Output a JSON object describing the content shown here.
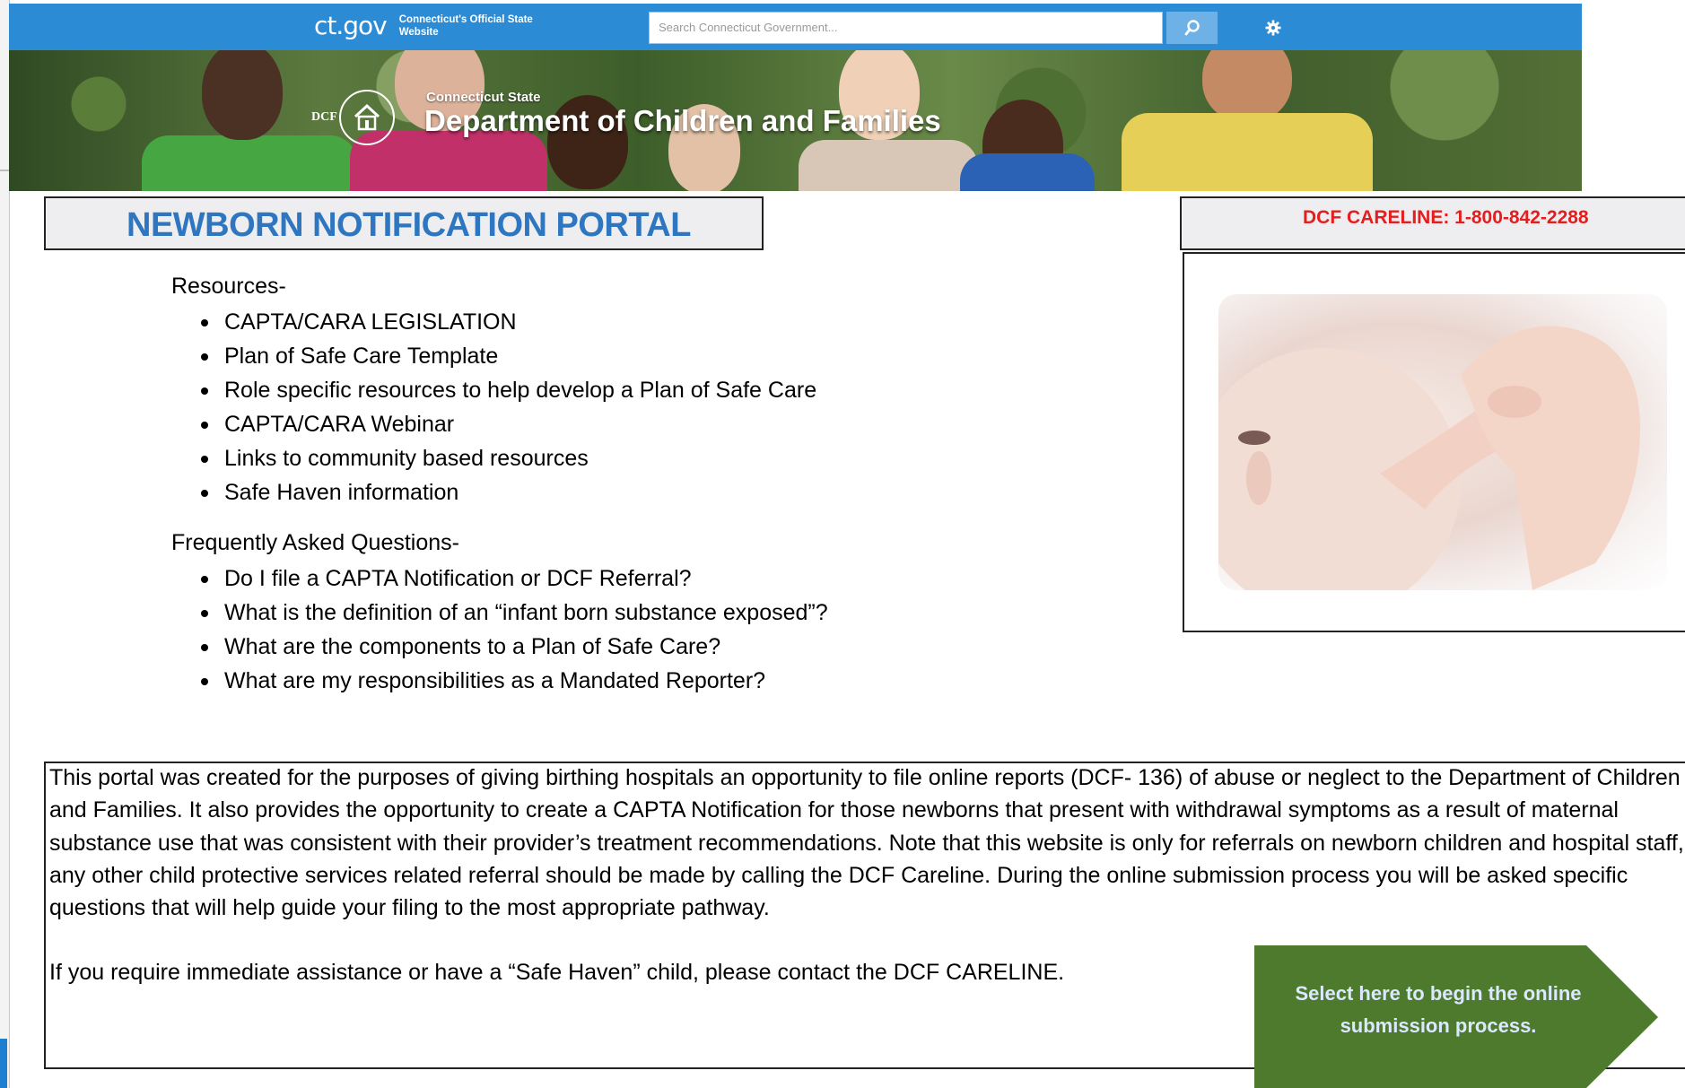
{
  "header": {
    "site_logo": "ct.gov",
    "site_tagline": "Connecticut's Official State Website",
    "search_placeholder": "Search Connecticut Government...",
    "search_icon": "search-icon",
    "settings_icon": "gear-icon"
  },
  "banner": {
    "logo_text": "DCF",
    "state_label": "Connecticut State",
    "department": "Department of Children and Families"
  },
  "page_title": "NEWBORN NOTIFICATION PORTAL",
  "careline": "DCF CARELINE: 1-800-842-2288",
  "resources": {
    "heading": "Resources-",
    "items": [
      "CAPTA/CARA LEGISLATION",
      "Plan of Safe Care Template",
      "Role specific resources to help develop a Plan of Safe Care",
      "CAPTA/CARA Webinar",
      "Links to community based resources",
      "Safe Haven information"
    ]
  },
  "faq": {
    "heading": "Frequently Asked Questions-",
    "items": [
      "Do I file a CAPTA Notification or DCF Referral?",
      "What is the definition of an “infant born substance exposed”?",
      "What are the components to a Plan of Safe Care?",
      "What are my responsibilities as a Mandated Reporter?"
    ]
  },
  "info": {
    "paragraph": "This portal was created for the purposes of giving birthing hospitals an opportunity to file online reports (DCF- 136) of abuse or neglect to the Department of Children and Families.  It also provides the opportunity to create a CAPTA Notification for those newborns that present with withdrawal symptoms as a result of maternal substance use that was consistent with their provider’s treatment recommendations.  Note that this website is only for referrals on newborn children and hospital staff, any other child protective services related referral should be made by calling the DCF Careline. During the online submission process you will be asked specific questions that will help guide your filing to the most appropriate pathway.",
    "assistance": "If you require immediate assistance or have a “Safe Haven” child, please contact the DCF CARELINE."
  },
  "cta": {
    "label": "Select here to begin the online submission process.",
    "color": "#4e7a2e"
  },
  "colors": {
    "topbar": "#2c8bd5",
    "title": "#2e77c0",
    "careline": "#e41e1e"
  }
}
